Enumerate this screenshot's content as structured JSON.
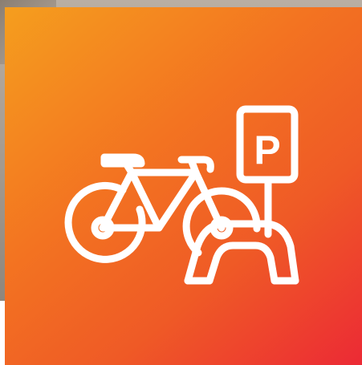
{
  "image": {
    "icon": "bicycle-parking-icon",
    "parking_sign_letter": "P",
    "colors": {
      "gradient_start": "#f59e1e",
      "gradient_mid": "#f37321",
      "gradient_end": "#ec2a35",
      "icon_stroke": "#ffffff",
      "backdrop": "#a99f94"
    }
  }
}
